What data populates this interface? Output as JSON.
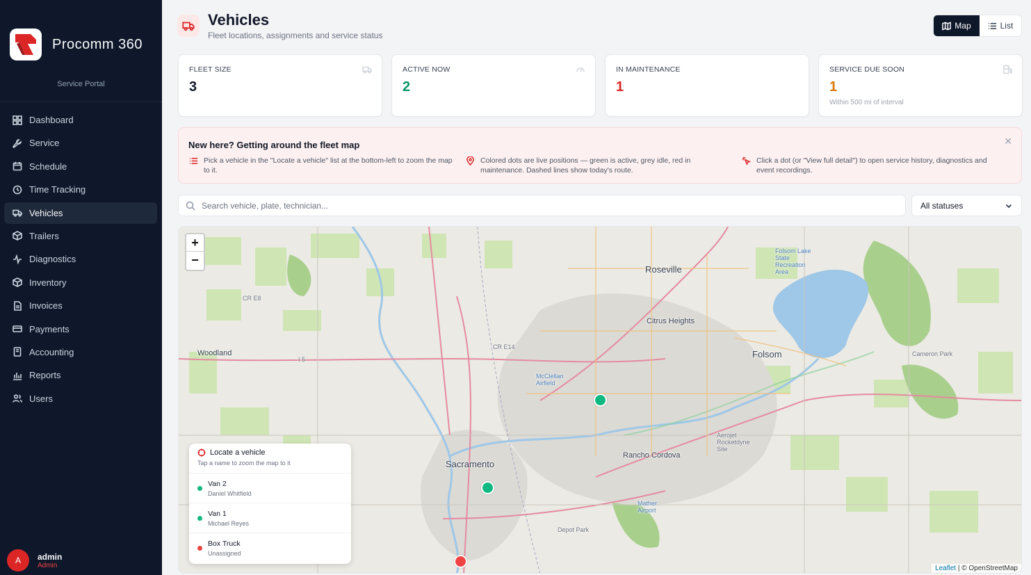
{
  "brand": {
    "name": "Procomm 360",
    "subtitle": "Service Portal"
  },
  "sidebar": {
    "items": [
      {
        "label": "Dashboard",
        "icon": "grid-icon"
      },
      {
        "label": "Service",
        "icon": "wrench-icon"
      },
      {
        "label": "Schedule",
        "icon": "calendar-icon"
      },
      {
        "label": "Time Tracking",
        "icon": "clock-icon"
      },
      {
        "label": "Vehicles",
        "icon": "truck-icon",
        "active": true
      },
      {
        "label": "Trailers",
        "icon": "box-icon"
      },
      {
        "label": "Diagnostics",
        "icon": "activity-icon"
      },
      {
        "label": "Inventory",
        "icon": "package-icon"
      },
      {
        "label": "Invoices",
        "icon": "file-icon"
      },
      {
        "label": "Payments",
        "icon": "credit-card-icon"
      },
      {
        "label": "Accounting",
        "icon": "book-icon"
      },
      {
        "label": "Reports",
        "icon": "bar-chart-icon"
      },
      {
        "label": "Users",
        "icon": "users-icon"
      }
    ]
  },
  "user": {
    "initial": "A",
    "name": "admin",
    "role": "Admin"
  },
  "header": {
    "title": "Vehicles",
    "subtitle": "Fleet locations, assignments and service status",
    "view_toggle": {
      "map_label": "Map",
      "list_label": "List",
      "selected": "Map"
    }
  },
  "stats": [
    {
      "label": "FLEET SIZE",
      "value": "3",
      "note": "",
      "color": "#111827",
      "icon": "truck-icon"
    },
    {
      "label": "ACTIVE NOW",
      "value": "2",
      "note": "",
      "color": "#059669",
      "icon": "gauge-icon"
    },
    {
      "label": "IN MAINTENANCE",
      "value": "1",
      "note": "",
      "color": "#dc2626",
      "icon": ""
    },
    {
      "label": "SERVICE DUE SOON",
      "value": "1",
      "note": "Within 500 mi of interval",
      "color": "#d97706",
      "icon": "fuel-icon"
    }
  ],
  "banner": {
    "title": "New here? Getting around the fleet map",
    "tips": [
      {
        "icon": "list-icon",
        "text": "Pick a vehicle in the \"Locate a vehicle\" list at the bottom-left to zoom the map to it."
      },
      {
        "icon": "map-pin-icon",
        "text": "Colored dots are live positions — green is active, grey idle, red in maintenance. Dashed lines show today's route."
      },
      {
        "icon": "pointer-icon",
        "text": "Click a dot (or \"View full detail\") to open service history, diagnostics and event recordings."
      }
    ]
  },
  "search": {
    "placeholder": "Search vehicle, plate, technician...",
    "value": ""
  },
  "status_filter": {
    "selected": "All statuses"
  },
  "map": {
    "zoom_in": "+",
    "zoom_out": "−",
    "attribution_leaflet": "Leaflet",
    "attribution_osm": "| © OpenStreetMap",
    "places": [
      "Roseville",
      "Citrus Heights",
      "Folsom",
      "Sacramento",
      "Rancho Cordova",
      "Woodland",
      "Cameron Park",
      "Folsom Lake State Recreation Area",
      "McClellan Airfield",
      "Aerojet Rocketdyne Site",
      "Mather Airport",
      "Depot Park",
      "CR E8",
      "CR E14",
      "I 5"
    ],
    "vehicle_colors": {
      "active": "#10b981",
      "maintenance": "#ef4444"
    }
  },
  "locate": {
    "title": "Locate a vehicle",
    "subtitle": "Tap a name to zoom the map to it",
    "vehicles": [
      {
        "name": "Van 2",
        "assignee": "Daniel Whitfield",
        "status": "active"
      },
      {
        "name": "Van 1",
        "assignee": "Michael Reyes",
        "status": "active"
      },
      {
        "name": "Box Truck",
        "assignee": "Unassigned",
        "status": "maintenance"
      }
    ]
  }
}
